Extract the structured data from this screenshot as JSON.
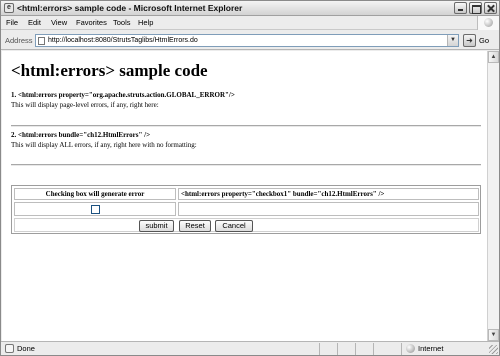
{
  "window": {
    "title": "<html:errors> sample code - Microsoft Internet Explorer"
  },
  "menu": {
    "items": [
      "File",
      "Edit",
      "View",
      "Favorites",
      "Tools",
      "Help"
    ]
  },
  "address": {
    "label": "Address",
    "url": "http://localhost:8080/StrutsTaglibs/HtmlErrors.do",
    "go_label": "Go"
  },
  "page": {
    "title": "<html:errors> sample code",
    "section1": {
      "heading": "1. <html:errors property=\"org.apache.struts.action.GLOBAL_ERROR\"/>",
      "description": "This will display page-level errors, if any, right here:"
    },
    "section2": {
      "heading": "2. <html:errors bundle=\"ch12.HtmlErrors\" />",
      "description": "This will display ALL errors, if any, right here with no formatting:"
    },
    "table": {
      "col1_header": "Checking box will generate error",
      "col2_header": "<html:errors property=\"checkbox1\" bundle=\"ch12.HtmlErrors\" />",
      "checkbox_checked": false,
      "buttons": {
        "submit": "submit",
        "reset": "Reset",
        "cancel": "Cancel"
      }
    }
  },
  "status": {
    "text": "Done",
    "zone": "Internet"
  },
  "icons": {
    "title": "ie-page-icon",
    "logo": "windows-logo-icon",
    "go": "go-arrow-icon",
    "status": "page-done-icon",
    "zone": "internet-zone-icon"
  }
}
